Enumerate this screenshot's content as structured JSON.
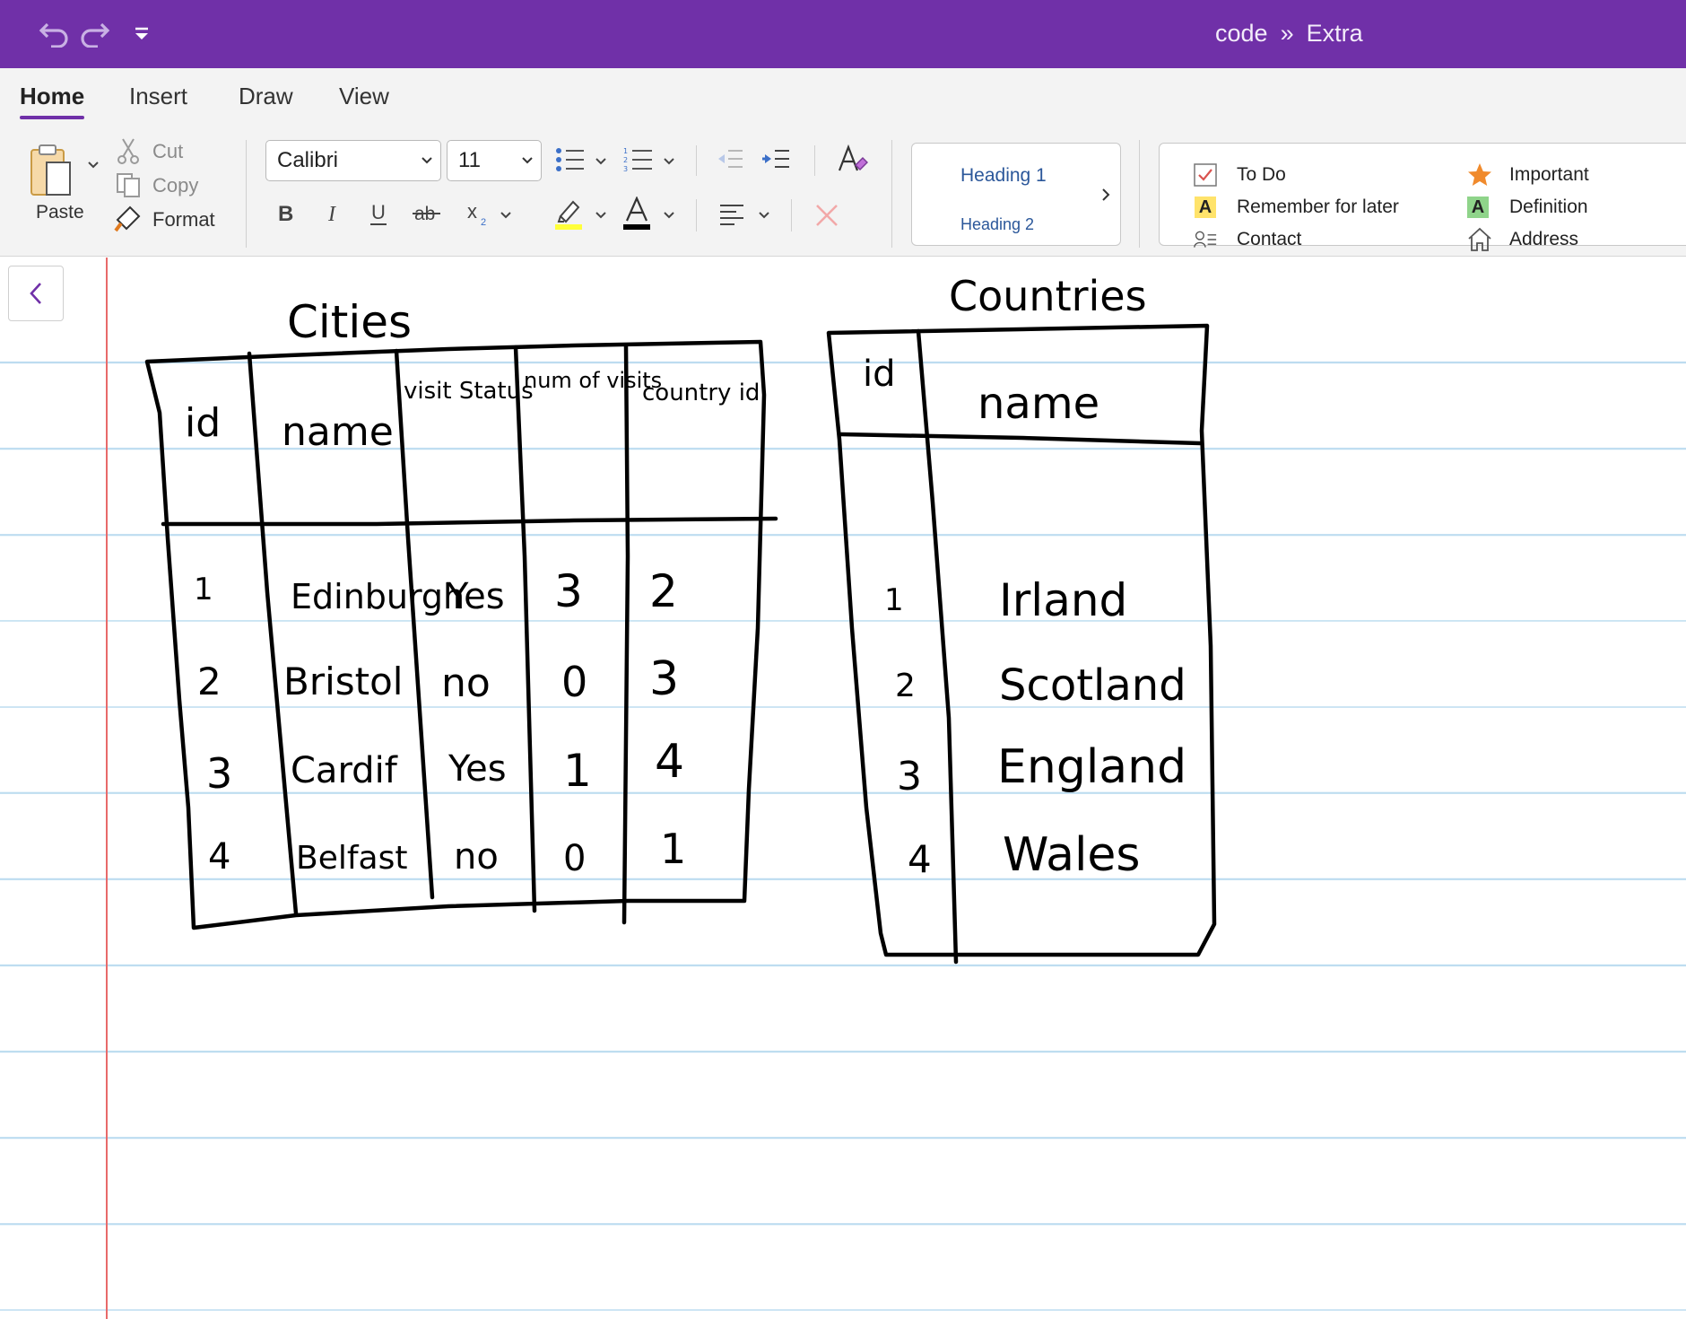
{
  "titlebar": {
    "notebook": "code",
    "separator": "»",
    "page": "Extra"
  },
  "tabs": [
    {
      "label": "Home",
      "active": true
    },
    {
      "label": "Insert",
      "active": false
    },
    {
      "label": "Draw",
      "active": false
    },
    {
      "label": "View",
      "active": false
    }
  ],
  "clipboard": {
    "paste_label": "Paste",
    "cut_label": "Cut",
    "copy_label": "Copy",
    "format_label": "Format"
  },
  "font": {
    "family": "Calibri",
    "size": "11"
  },
  "styles": {
    "heading1": "Heading 1",
    "heading2": "Heading 2"
  },
  "tags": {
    "todo": "To Do",
    "remember": "Remember for later",
    "contact": "Contact",
    "important": "Important",
    "definition": "Definition",
    "address": "Address"
  },
  "colors": {
    "accent": "#7030a8",
    "highlight": "#ffff3a",
    "font_color": "#000000",
    "margin_line": "#e86a6a",
    "rule_line": "#bcdcf0"
  },
  "ink": {
    "cities": {
      "title": "Cities",
      "headers": [
        "id",
        "name",
        "visit Status",
        "num of visits",
        "country id"
      ],
      "rows": [
        [
          "1",
          "Edinburgh",
          "Yes",
          "3",
          "2"
        ],
        [
          "2",
          "Bristol",
          "no",
          "0",
          "3"
        ],
        [
          "3",
          "Cardif",
          "Yes",
          "1",
          "4"
        ],
        [
          "4",
          "Belfast",
          "no",
          "0",
          "1"
        ]
      ]
    },
    "countries": {
      "title": "Countries",
      "headers": [
        "id",
        "name"
      ],
      "rows": [
        [
          "1",
          "Irland"
        ],
        [
          "2",
          "Scotland"
        ],
        [
          "3",
          "England"
        ],
        [
          "4",
          "Wales"
        ]
      ]
    }
  }
}
